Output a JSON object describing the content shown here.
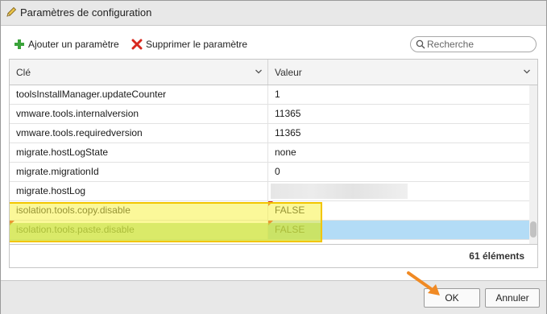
{
  "window": {
    "title": "Paramètres de configuration",
    "title_icon": "pencil-icon"
  },
  "toolbar": {
    "add_label": "Ajouter un paramètre",
    "add_icon": "plus-icon",
    "delete_label": "Supprimer le paramètre",
    "delete_icon": "x-icon",
    "search_placeholder": "Recherche"
  },
  "table": {
    "columns": [
      "Clé",
      "Valeur"
    ],
    "rows": [
      {
        "key": "toolsInstallManager.updateCounter",
        "value": "1"
      },
      {
        "key": "vmware.tools.internalversion",
        "value": "11365"
      },
      {
        "key": "vmware.tools.requiredversion",
        "value": "11365"
      },
      {
        "key": "migrate.hostLogState",
        "value": "none"
      },
      {
        "key": "migrate.migrationId",
        "value": "0"
      },
      {
        "key": "migrate.hostLog",
        "value": ""
      },
      {
        "key": "isolation.tools.copy.disable",
        "value": "FALSE"
      },
      {
        "key": "isolation.tools.paste.disable",
        "value": "FALSE"
      }
    ],
    "count": "61 éléments"
  },
  "buttons": {
    "ok": "OK",
    "cancel": "Annuler"
  },
  "colors": {
    "highlight_yellow": "#f7f346",
    "highlight_green": "#78c83c",
    "selected_row": "#b3dcf6",
    "annotation_arrow": "#f08a24"
  }
}
